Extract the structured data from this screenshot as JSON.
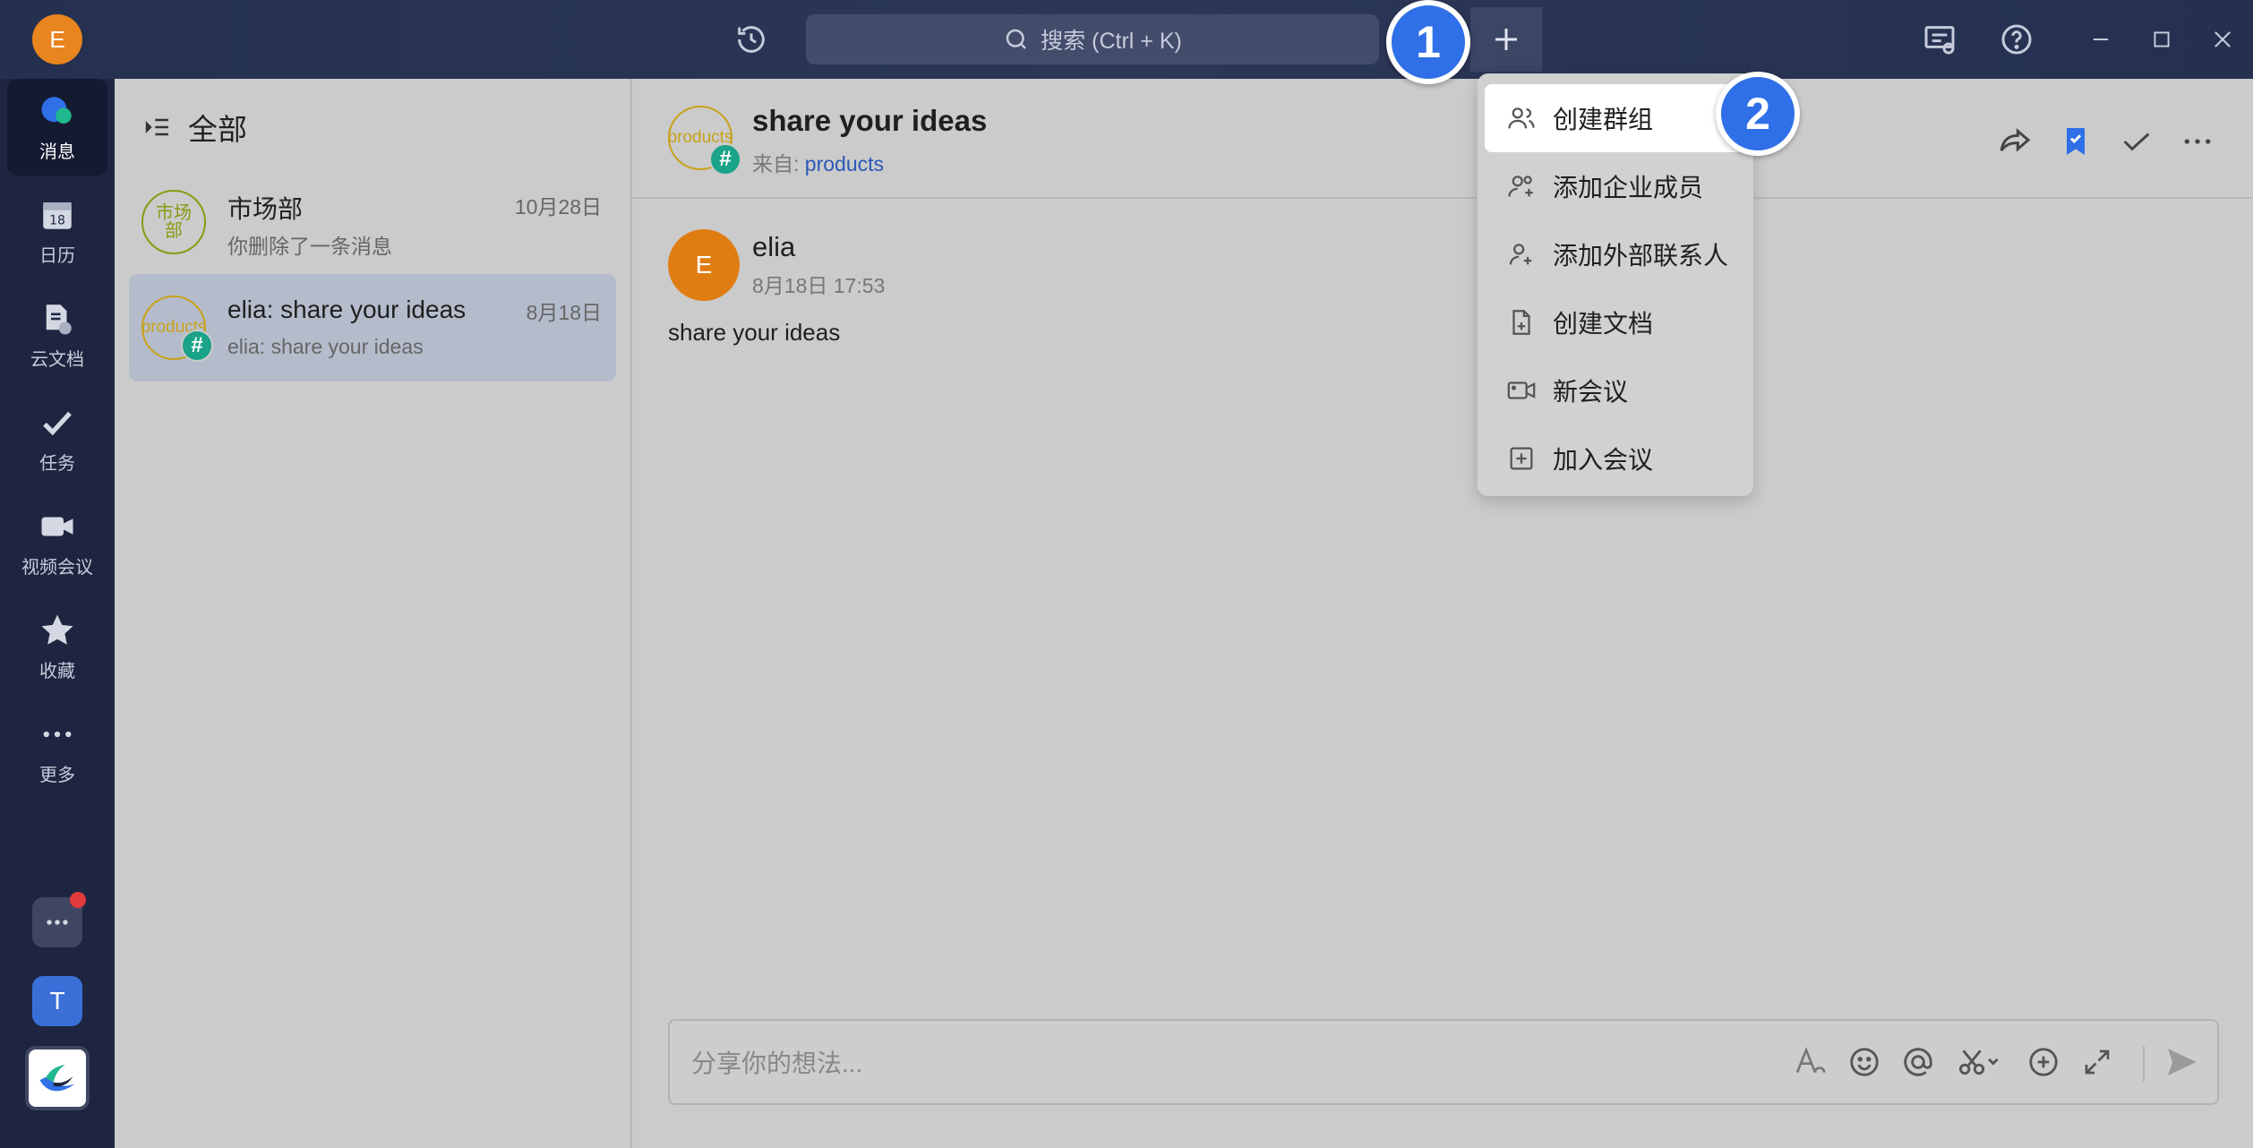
{
  "titlebar": {
    "avatar_letter": "E",
    "search_label": "搜索 (Ctrl + K)"
  },
  "rail": {
    "items": [
      {
        "label": "消息",
        "icon": "chat-icon"
      },
      {
        "label": "日历",
        "icon": "calendar-icon",
        "calendar_day": "18"
      },
      {
        "label": "云文档",
        "icon": "cloud-doc-icon"
      },
      {
        "label": "任务",
        "icon": "task-icon"
      },
      {
        "label": "视频会议",
        "icon": "video-icon"
      },
      {
        "label": "收藏",
        "icon": "star-icon"
      },
      {
        "label": "更多",
        "icon": "more-icon"
      }
    ],
    "bottom_app_letter": "T"
  },
  "list": {
    "header": "全部",
    "conversations": [
      {
        "avatar_text": "市场部",
        "title": "市场部",
        "subtitle": "你删除了一条消息",
        "date": "10月28日"
      },
      {
        "avatar_text": "products",
        "title": "elia: share your ideas",
        "subtitle": "elia: share your ideas",
        "date": "8月18日"
      }
    ]
  },
  "chat": {
    "avatar_text": "products",
    "title": "share your ideas",
    "from_label": "来自: ",
    "from_link": "products",
    "message": {
      "avatar_letter": "E",
      "author": "elia",
      "time": "8月18日 17:53",
      "text": "share your ideas"
    },
    "composer_placeholder": "分享你的想法..."
  },
  "dropdown": {
    "items": [
      {
        "label": "创建群组",
        "icon": "group-icon"
      },
      {
        "label": "添加企业成员",
        "icon": "add-members-icon"
      },
      {
        "label": "添加外部联系人",
        "icon": "add-contact-icon"
      },
      {
        "label": "创建文档",
        "icon": "new-doc-icon"
      },
      {
        "label": "新会议",
        "icon": "new-meeting-icon"
      },
      {
        "label": "加入会议",
        "icon": "join-meeting-icon"
      }
    ]
  },
  "steps": [
    "1",
    "2"
  ],
  "colors": {
    "accent": "#2f6fe7",
    "hash_badge": "#1aa388",
    "avatar_orange": "#e07d12",
    "notification": "#e03a3a"
  }
}
